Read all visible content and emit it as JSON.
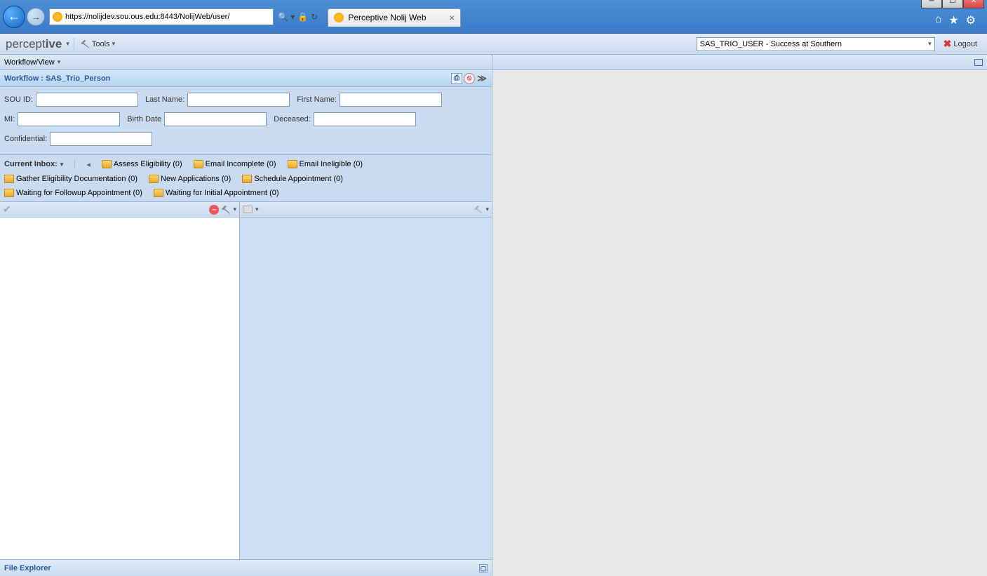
{
  "browser": {
    "url": "https://nolijdev.sou.ous.edu:8443/NolijWeb/user/",
    "tab_title": "Perceptive Nolij Web"
  },
  "toolbar": {
    "brand_light": "percept",
    "brand_bold": "ive",
    "tools_label": "Tools",
    "user_select": "SAS_TRIO_USER - Success at Southern",
    "logout_label": "Logout"
  },
  "workflow": {
    "view_label": "Workflow/View",
    "header": "Workflow : SAS_Trio_Person"
  },
  "form": {
    "sou_id_label": "SOU ID:",
    "last_name_label": "Last Name:",
    "first_name_label": "First Name:",
    "mi_label": "MI:",
    "birth_date_label": "Birth Date",
    "deceased_label": "Deceased:",
    "confidential_label": "Confidential:"
  },
  "inbox": {
    "label": "Current Inbox:",
    "items": [
      "Assess Eligibility (0)",
      "Email Incomplete (0)",
      "Email Ineligible (0)",
      "Gather Eligibility Documentation (0)",
      "New Applications (0)",
      "Schedule Appointment (0)",
      "Waiting for Followup Appointment (0)",
      "Waiting for Initial Appointment (0)"
    ]
  },
  "footer": {
    "file_explorer": "File Explorer"
  }
}
